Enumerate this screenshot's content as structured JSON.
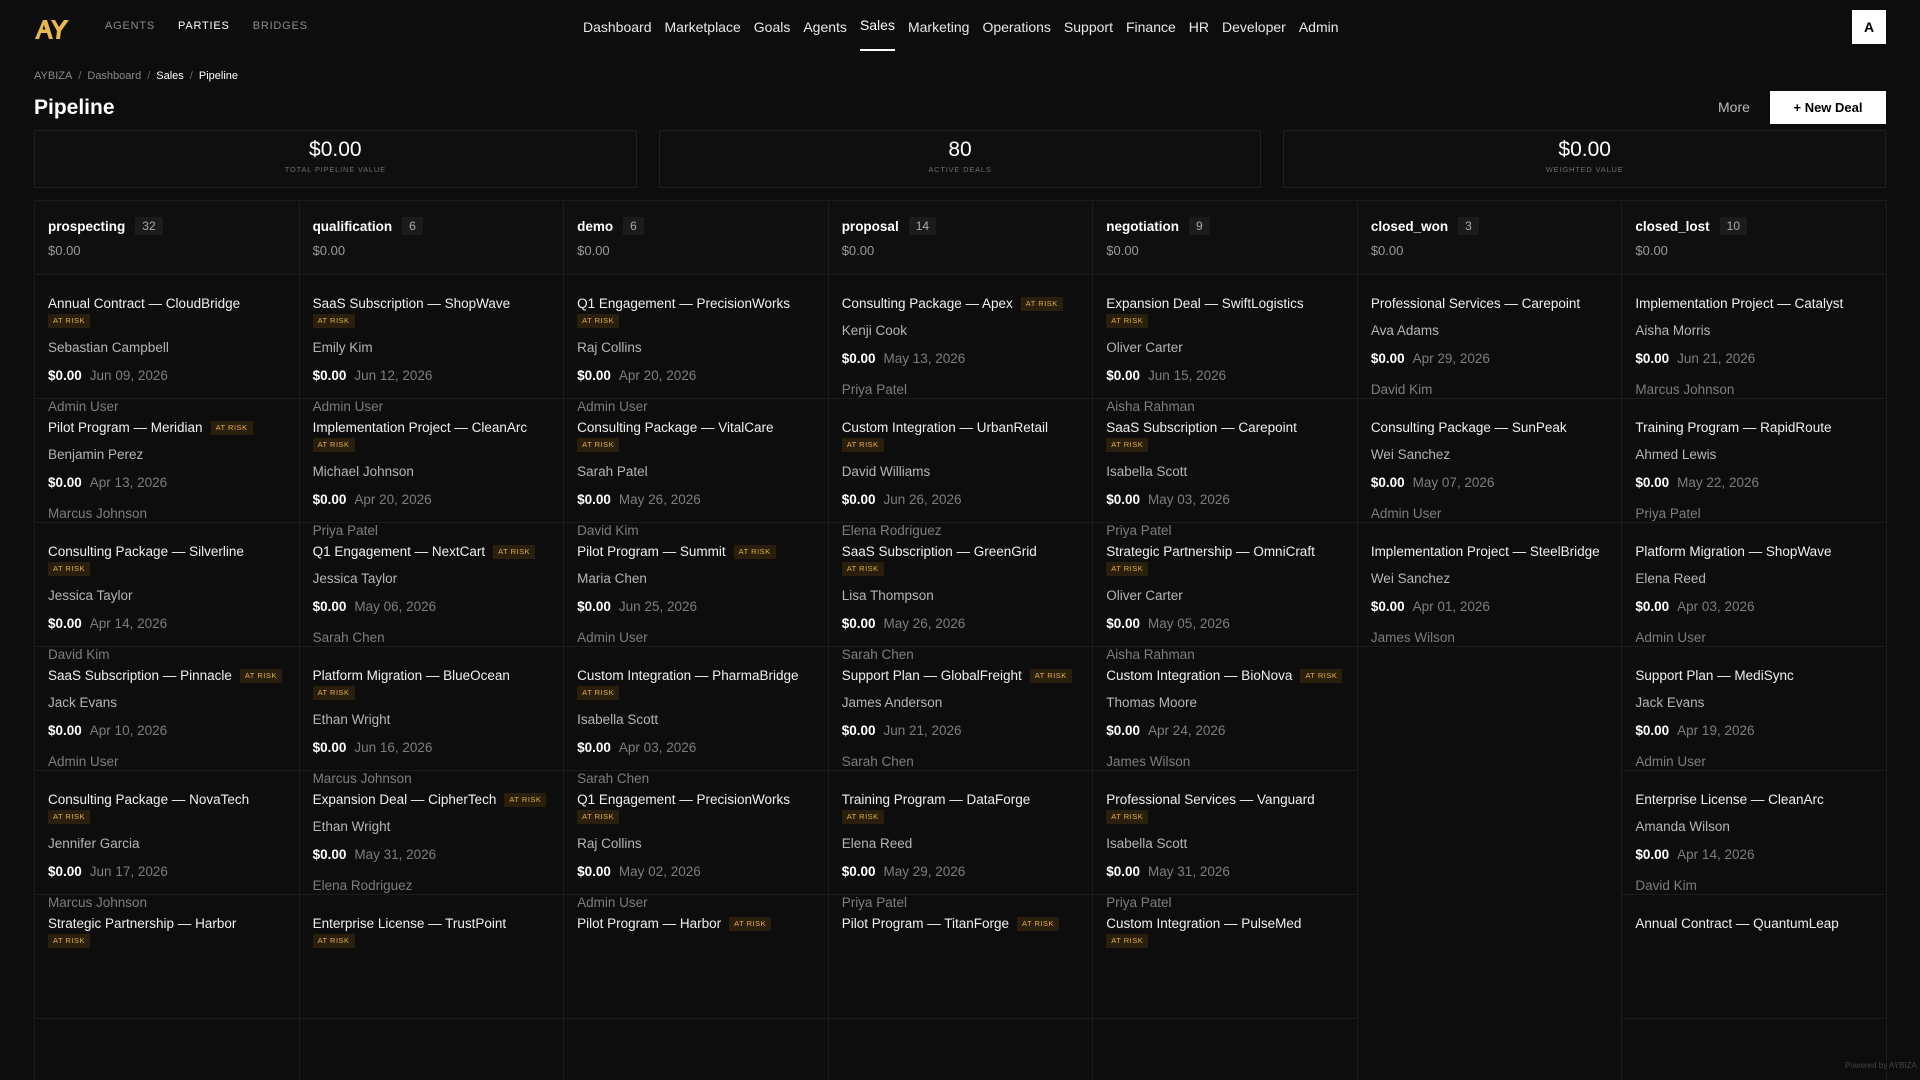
{
  "nav": {
    "left_tabs": [
      {
        "label": "AGENTS",
        "active": false
      },
      {
        "label": "PARTIES",
        "active": true
      },
      {
        "label": "BRIDGES",
        "active": false
      }
    ],
    "main_items": [
      {
        "label": "Dashboard"
      },
      {
        "label": "Marketplace"
      },
      {
        "label": "Goals"
      },
      {
        "label": "Agents"
      },
      {
        "label": "Sales",
        "active": true
      },
      {
        "label": "Marketing"
      },
      {
        "label": "Operations"
      },
      {
        "label": "Support"
      },
      {
        "label": "Finance"
      },
      {
        "label": "HR"
      },
      {
        "label": "Developer"
      },
      {
        "label": "Admin"
      }
    ],
    "avatar": "A"
  },
  "breadcrumb": [
    "AYBIZA",
    "Dashboard",
    "Sales",
    "Pipeline"
  ],
  "page": {
    "title": "Pipeline",
    "more_label": "More",
    "new_deal_label": "+ New Deal"
  },
  "stats": [
    {
      "value": "$0.00",
      "label": "TOTAL PIPELINE VALUE"
    },
    {
      "value": "80",
      "label": "ACTIVE DEALS"
    },
    {
      "value": "$0.00",
      "label": "WEIGHTED VALUE"
    }
  ],
  "columns": [
    {
      "name": "prospecting",
      "count": "32",
      "total": "$0.00",
      "cards": [
        {
          "title": "Annual Contract — CloudBridge",
          "at_risk": true,
          "contact": "Sebastian Campbell",
          "amount": "$0.00",
          "date": "Jun 09, 2026",
          "owner": "Admin User"
        },
        {
          "title": "Pilot Program — Meridian",
          "at_risk": true,
          "contact": "Benjamin Perez",
          "amount": "$0.00",
          "date": "Apr 13, 2026",
          "owner": "Marcus Johnson"
        },
        {
          "title": "Consulting Package — Silverline",
          "at_risk": true,
          "contact": "Jessica Taylor",
          "amount": "$0.00",
          "date": "Apr 14, 2026",
          "owner": "David Kim"
        },
        {
          "title": "SaaS Subscription — Pinnacle",
          "at_risk": true,
          "contact": "Jack Evans",
          "amount": "$0.00",
          "date": "Apr 10, 2026",
          "owner": "Admin User"
        },
        {
          "title": "Consulting Package — NovaTech",
          "at_risk": true,
          "contact": "Jennifer Garcia",
          "amount": "$0.00",
          "date": "Jun 17, 2026",
          "owner": "Marcus Johnson"
        },
        {
          "title": "Strategic Partnership — Harbor",
          "at_risk": true,
          "contact": "",
          "amount": "",
          "date": "",
          "owner": ""
        }
      ]
    },
    {
      "name": "qualification",
      "count": "6",
      "total": "$0.00",
      "cards": [
        {
          "title": "SaaS Subscription — ShopWave",
          "at_risk": true,
          "contact": "Emily Kim",
          "amount": "$0.00",
          "date": "Jun 12, 2026",
          "owner": "Admin User"
        },
        {
          "title": "Implementation Project — CleanArc",
          "at_risk": true,
          "contact": "Michael Johnson",
          "amount": "$0.00",
          "date": "Apr 20, 2026",
          "owner": "Priya Patel"
        },
        {
          "title": "Q1 Engagement — NextCart",
          "at_risk": true,
          "contact": "Jessica Taylor",
          "amount": "$0.00",
          "date": "May 06, 2026",
          "owner": "Sarah Chen"
        },
        {
          "title": "Platform Migration — BlueOcean",
          "at_risk": true,
          "contact": "Ethan Wright",
          "amount": "$0.00",
          "date": "Jun 16, 2026",
          "owner": "Marcus Johnson"
        },
        {
          "title": "Expansion Deal — CipherTech",
          "at_risk": true,
          "contact": "Ethan Wright",
          "amount": "$0.00",
          "date": "May 31, 2026",
          "owner": "Elena Rodriguez"
        },
        {
          "title": "Enterprise License — TrustPoint",
          "at_risk": true,
          "contact": "",
          "amount": "",
          "date": "",
          "owner": ""
        }
      ]
    },
    {
      "name": "demo",
      "count": "6",
      "total": "$0.00",
      "cards": [
        {
          "title": "Q1 Engagement — PrecisionWorks",
          "at_risk": true,
          "contact": "Raj Collins",
          "amount": "$0.00",
          "date": "Apr 20, 2026",
          "owner": "Admin User"
        },
        {
          "title": "Consulting Package — VitalCare",
          "at_risk": true,
          "contact": "Sarah Patel",
          "amount": "$0.00",
          "date": "May 26, 2026",
          "owner": "David Kim"
        },
        {
          "title": "Pilot Program — Summit",
          "at_risk": true,
          "contact": "Maria Chen",
          "amount": "$0.00",
          "date": "Jun 25, 2026",
          "owner": "Admin User"
        },
        {
          "title": "Custom Integration — PharmaBridge",
          "at_risk": true,
          "contact": "Isabella Scott",
          "amount": "$0.00",
          "date": "Apr 03, 2026",
          "owner": "Sarah Chen"
        },
        {
          "title": "Q1 Engagement — PrecisionWorks",
          "at_risk": true,
          "contact": "Raj Collins",
          "amount": "$0.00",
          "date": "May 02, 2026",
          "owner": "Admin User"
        },
        {
          "title": "Pilot Program — Harbor",
          "at_risk": true,
          "contact": "",
          "amount": "",
          "date": "",
          "owner": ""
        }
      ]
    },
    {
      "name": "proposal",
      "count": "14",
      "total": "$0.00",
      "cards": [
        {
          "title": "Consulting Package — Apex",
          "at_risk": true,
          "contact": "Kenji Cook",
          "amount": "$0.00",
          "date": "May 13, 2026",
          "owner": "Priya Patel"
        },
        {
          "title": "Custom Integration — UrbanRetail",
          "at_risk": true,
          "contact": "David Williams",
          "amount": "$0.00",
          "date": "Jun 26, 2026",
          "owner": "Elena Rodriguez"
        },
        {
          "title": "SaaS Subscription — GreenGrid",
          "at_risk": true,
          "contact": "Lisa Thompson",
          "amount": "$0.00",
          "date": "May 26, 2026",
          "owner": "Sarah Chen"
        },
        {
          "title": "Support Plan — GlobalFreight",
          "at_risk": true,
          "contact": "James Anderson",
          "amount": "$0.00",
          "date": "Jun 21, 2026",
          "owner": "Sarah Chen"
        },
        {
          "title": "Training Program — DataForge",
          "at_risk": true,
          "contact": "Elena Reed",
          "amount": "$0.00",
          "date": "May 29, 2026",
          "owner": "Priya Patel"
        },
        {
          "title": "Pilot Program — TitanForge",
          "at_risk": true,
          "contact": "",
          "amount": "",
          "date": "",
          "owner": ""
        }
      ]
    },
    {
      "name": "negotiation",
      "count": "9",
      "total": "$0.00",
      "cards": [
        {
          "title": "Expansion Deal — SwiftLogistics",
          "at_risk": true,
          "contact": "Oliver Carter",
          "amount": "$0.00",
          "date": "Jun 15, 2026",
          "owner": "Aisha Rahman"
        },
        {
          "title": "SaaS Subscription — Carepoint",
          "at_risk": true,
          "contact": "Isabella Scott",
          "amount": "$0.00",
          "date": "May 03, 2026",
          "owner": "Priya Patel"
        },
        {
          "title": "Strategic Partnership — OmniCraft",
          "at_risk": true,
          "contact": "Oliver Carter",
          "amount": "$0.00",
          "date": "May 05, 2026",
          "owner": "Aisha Rahman"
        },
        {
          "title": "Custom Integration — BioNova",
          "at_risk": true,
          "contact": "Thomas Moore",
          "amount": "$0.00",
          "date": "Apr 24, 2026",
          "owner": "James Wilson"
        },
        {
          "title": "Professional Services — Vanguard",
          "at_risk": true,
          "contact": "Isabella Scott",
          "amount": "$0.00",
          "date": "May 31, 2026",
          "owner": "Priya Patel"
        },
        {
          "title": "Custom Integration — PulseMed",
          "at_risk": true,
          "contact": "",
          "amount": "",
          "date": "",
          "owner": ""
        }
      ]
    },
    {
      "name": "closed_won",
      "count": "3",
      "total": "$0.00",
      "cards": [
        {
          "title": "Professional Services — Carepoint",
          "at_risk": false,
          "contact": "Ava Adams",
          "amount": "$0.00",
          "date": "Apr 29, 2026",
          "owner": "David Kim"
        },
        {
          "title": "Consulting Package — SunPeak",
          "at_risk": false,
          "contact": "Wei Sanchez",
          "amount": "$0.00",
          "date": "May 07, 2026",
          "owner": "Admin User"
        },
        {
          "title": "Implementation Project — SteelBridge",
          "at_risk": false,
          "contact": "Wei Sanchez",
          "amount": "$0.00",
          "date": "Apr 01, 2026",
          "owner": "James Wilson"
        }
      ]
    },
    {
      "name": "closed_lost",
      "count": "10",
      "total": "$0.00",
      "cards": [
        {
          "title": "Implementation Project — Catalyst",
          "at_risk": false,
          "contact": "Aisha Morris",
          "amount": "$0.00",
          "date": "Jun 21, 2026",
          "owner": "Marcus Johnson"
        },
        {
          "title": "Training Program — RapidRoute",
          "at_risk": false,
          "contact": "Ahmed Lewis",
          "amount": "$0.00",
          "date": "May 22, 2026",
          "owner": "Priya Patel"
        },
        {
          "title": "Platform Migration — ShopWave",
          "at_risk": false,
          "contact": "Elena Reed",
          "amount": "$0.00",
          "date": "Apr 03, 2026",
          "owner": "Admin User"
        },
        {
          "title": "Support Plan — MediSync",
          "at_risk": false,
          "contact": "Jack Evans",
          "amount": "$0.00",
          "date": "Apr 19, 2026",
          "owner": "Admin User"
        },
        {
          "title": "Enterprise License — CleanArc",
          "at_risk": false,
          "contact": "Amanda Wilson",
          "amount": "$0.00",
          "date": "Apr 14, 2026",
          "owner": "David Kim"
        },
        {
          "title": "Annual Contract — QuantumLeap",
          "at_risk": false,
          "contact": "",
          "amount": "",
          "date": "",
          "owner": ""
        }
      ]
    }
  ],
  "badge_label": "AT RISK",
  "footer": "Powered by AYBIZA",
  "colors": {
    "background": "#0d0d0d",
    "accent": "#ffffff",
    "at_risk": "#e0b040",
    "logo": "#e8b94a"
  }
}
